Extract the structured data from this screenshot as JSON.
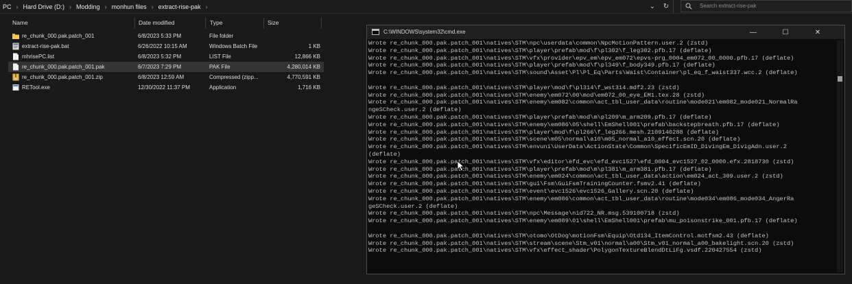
{
  "address": {
    "crumbs": [
      "PC",
      "Hard Drive (D:)",
      "Modding",
      "monhun files",
      "extract-rise-pak"
    ],
    "search_placeholder": "Search extract-rise-pak"
  },
  "columns": {
    "name": "Name",
    "date": "Date modified",
    "type": "Type",
    "size": "Size"
  },
  "files": [
    {
      "name": "re_chunk_000.pak.patch_001",
      "date": "6/8/2023 5:33 PM",
      "type": "File folder",
      "size": "",
      "icon": "folder-icon"
    },
    {
      "name": "extract-rise-pak.bat",
      "date": "6/26/2022 10:15 AM",
      "type": "Windows Batch File",
      "size": "1 KB",
      "icon": "batch-file-icon"
    },
    {
      "name": "mhrisePC.list",
      "date": "6/8/2023 5:32 PM",
      "type": "LIST File",
      "size": "12,866 KB",
      "icon": "file-icon"
    },
    {
      "name": "re_chunk_000.pak.patch_001.pak",
      "date": "6/7/2023 7:29 PM",
      "type": "PAK File",
      "size": "4,280,014 KB",
      "icon": "file-icon",
      "selected": true
    },
    {
      "name": "re_chunk_000.pak.patch_001.zip",
      "date": "6/8/2023 12:59 AM",
      "type": "Compressed (zipp...",
      "size": "4,770,591 KB",
      "icon": "zip-icon"
    },
    {
      "name": "RETool.exe",
      "date": "12/30/2022 11:37 PM",
      "type": "Application",
      "size": "1,716 KB",
      "icon": "exe-icon"
    }
  ],
  "cmd": {
    "title": "C:\\WINDOWS\\system32\\cmd.exe",
    "lines": [
      "Wrote re_chunk_000.pak.patch_001\\natives\\STM\\npc\\userdata\\common\\NpcMotionPattern.user.2 (zstd)",
      "Wrote re_chunk_000.pak.patch_001\\natives\\STM\\player\\prefab\\mod\\f\\pl302\\f_leg302.pfb.17 (deflate)",
      "Wrote re_chunk_000.pak.patch_001\\natives\\STM\\vfx\\provider\\epv_em\\epv_em072\\epvs-prg_0004_em072_00_0000.pfb.17 (deflate)",
      "Wrote re_chunk_000.pak.patch_001\\natives\\STM\\player\\prefab\\mod\\f\\pl349\\f_body349.pfb.17 (deflate)",
      "Wrote re_chunk_000.pak.patch_001\\natives\\STM\\sound\\Asset\\Pl\\Pl_Eq\\Parts\\Waist\\Container\\pl_eq_f_waist337.wcc.2 (deflate)",
      "",
      "Wrote re_chunk_000.pak.patch_001\\natives\\STM\\player\\mod\\f\\pl314\\f_wst314.mdf2.23 (zstd)",
      "Wrote re_chunk_000.pak.patch_001\\natives\\STM\\enemy\\em072\\00\\mod\\em072_00_eye_EM1.tex.28 (zstd)",
      "Wrote re_chunk_000.pak.patch_001\\natives\\STM\\enemy\\em082\\common\\act_tbl_user_data\\routine\\mode021\\em082_mode021_NormalRa",
      "ngeSCheck.user.2 (deflate)",
      "Wrote re_chunk_000.pak.patch_001\\natives\\STM\\player\\prefab\\mod\\m\\pl209\\m_arm209.pfb.17 (deflate)",
      "Wrote re_chunk_000.pak.patch_001\\natives\\STM\\enemy\\em086\\05\\shell\\EmShell001\\prefab\\backstepbreath.pfb.17 (deflate)",
      "Wrote re_chunk_000.pak.patch_001\\natives\\STM\\player\\mod\\f\\pl266\\f_leg266.mesh.2109140288 (deflate)",
      "Wrote re_chunk_000.pak.patch_001\\natives\\STM\\scene\\m05\\normal\\a10\\m05_normal_a10_effect.scn.20 (deflate)",
      "Wrote re_chunk_000.pak.patch_001\\natives\\STM\\envuni\\UserData\\ActionState\\Common\\SpecificEmID_DivingEm_DivigAdn.user.2",
      "(deflate)",
      "Wrote re_chunk_000.pak.patch_001\\natives\\STM\\vfx\\editor\\efd_evc\\efd_evc1527\\efd_0004_evc1527_02_0000.efx.2818730 (zstd)",
      "Wrote re_chunk_000.pak.patch_001\\natives\\STM\\player\\prefab\\mod\\m\\pl381\\m_arm381.pfb.17 (deflate)",
      "Wrote re_chunk_000.pak.patch_001\\natives\\STM\\enemy\\em024\\common\\act_tbl_user_data\\action\\em024_act_309.user.2 (zstd)",
      "Wrote re_chunk_000.pak.patch_001\\natives\\STM\\gui\\Fsm\\GuiFsmTrainingCounter.fsmv2.41 (deflate)",
      "Wrote re_chunk_000.pak.patch_001\\natives\\STM\\event\\evc1526\\evc1526_Gallery.scn.20 (deflate)",
      "Wrote re_chunk_000.pak.patch_001\\natives\\STM\\enemy\\em086\\common\\act_tbl_user_data\\routine\\mode034\\em086_mode034_AngerRa",
      "geSCheck.user.2 (deflate)",
      "Wrote re_chunk_000.pak.patch_001\\natives\\STM\\npc\\Message\\nid722_NR.msg.539100718 (zstd)",
      "Wrote re_chunk_000.pak.patch_001\\natives\\STM\\enemy\\em089\\01\\shell\\EmShell001\\prefab\\mu_poisonstrike_001.pfb.17 (deflate)",
      "",
      "Wrote re_chunk_000.pak.patch_001\\natives\\STM\\otomo\\OtDog\\motionFsm\\Equip\\Otd134_ItemControl.motfsm2.43 (deflate)",
      "Wrote re_chunk_000.pak.patch_001\\natives\\STM\\stream\\scene\\Stm_v01\\normal\\a00\\Stm_v01_normal_a00_bakelight.scn.20 (zstd)",
      "Wrote re_chunk_000.pak.patch_001\\natives\\STM\\vfx\\effect_shader\\PolygonTextureBlendDtLiFg.vsdf.220427554 (zstd)"
    ]
  },
  "colors": {
    "background": "#191919",
    "selected_row": "#343434",
    "folder": "#e8b64a",
    "console_text": "#c2c2c2"
  }
}
